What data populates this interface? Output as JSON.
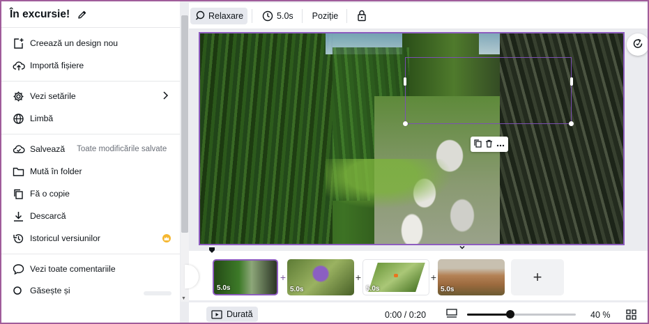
{
  "menu": {
    "title": "În excursie!",
    "items": [
      {
        "label": "Creează un design nou",
        "icon": "new-design-icon"
      },
      {
        "label": "Importă fișiere",
        "icon": "upload-cloud-icon"
      },
      {
        "label": "Vezi setările",
        "icon": "gear-icon"
      },
      {
        "label": "Limbă",
        "icon": "globe-icon"
      },
      {
        "label": "Salvează",
        "hint": "Toate modificările salvate",
        "icon": "cloud-check-icon"
      },
      {
        "label": "Mută în folder",
        "icon": "folder-icon"
      },
      {
        "label": "Fă o copie",
        "icon": "copy-icon"
      },
      {
        "label": "Descarcă",
        "icon": "download-icon"
      },
      {
        "label": "Istoricul versiunilor",
        "icon": "history-icon"
      },
      {
        "label": "Vezi toate comentariile",
        "icon": "comment-icon"
      },
      {
        "label": "Găsește și",
        "icon": "search-icon"
      }
    ]
  },
  "toolbar": {
    "relax_label": "Relaxare",
    "duration_label": "5.0s",
    "position_label": "Poziție"
  },
  "timeline": {
    "pages": [
      {
        "duration": "5.0s",
        "scene": "forest-stream"
      },
      {
        "duration": "5.0s",
        "scene": "purple-flower"
      },
      {
        "duration": "5.0s",
        "scene": "butterfly-leaf"
      },
      {
        "duration": "5.0s",
        "scene": "autumn-hills"
      }
    ],
    "add_label": "+"
  },
  "bottom": {
    "durata_label": "Durată",
    "time": "0:00 / 0:20",
    "zoom": "40 %",
    "zoom_level": 0.4
  },
  "colors": {
    "accent": "#8d5cbf",
    "frame": "#a05c9a",
    "badge": "#f5b731"
  }
}
